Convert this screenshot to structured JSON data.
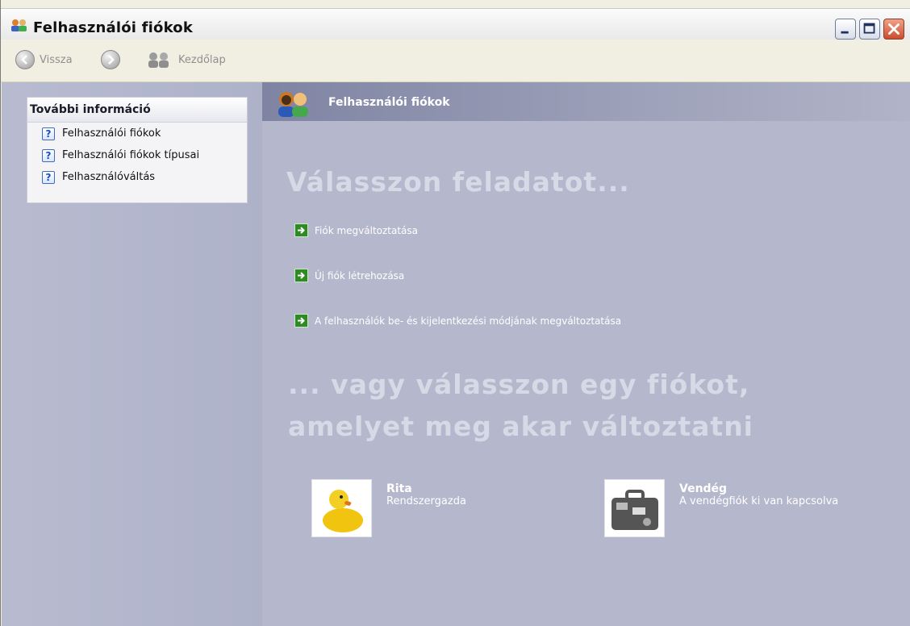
{
  "window": {
    "title": "Felhasználói fiókok",
    "controls": {
      "minimize_icon": "minimize-icon",
      "maximize_icon": "maximize-icon",
      "close_icon": "close-icon"
    }
  },
  "toolbar": {
    "back_label": "Vissza",
    "home_label": "Kezdőlap"
  },
  "sidebar": {
    "info_header": "További információ",
    "items": [
      {
        "label": "Felhasználói fiókok"
      },
      {
        "label": "Felhasználói fiókok típusai"
      },
      {
        "label": "Felhasználóváltás"
      }
    ]
  },
  "main": {
    "header_title": "Felhasználói fiókok",
    "pick_task_title": "Válasszon feladatot...",
    "tasks": [
      {
        "label": "Fiók megváltoztatása"
      },
      {
        "label": "Új fiók létrehozása"
      },
      {
        "label": "A felhasználók be- és kijelentkezési módjának megváltoztatása"
      }
    ],
    "pick_account_title": "... vagy válasszon egy fiókot, amelyet meg akar változtatni",
    "accounts": [
      {
        "name": "Rita",
        "role": "Rendszergazda"
      },
      {
        "name": "Vendég",
        "role": "A vendégfiók ki van kapcsolva"
      }
    ]
  },
  "colors": {
    "sidebar_bg": "#b8bbd0",
    "main_bg": "#b5b7cd",
    "header_bar": "#7f84a3",
    "task_arrow": "#2e8a22"
  }
}
